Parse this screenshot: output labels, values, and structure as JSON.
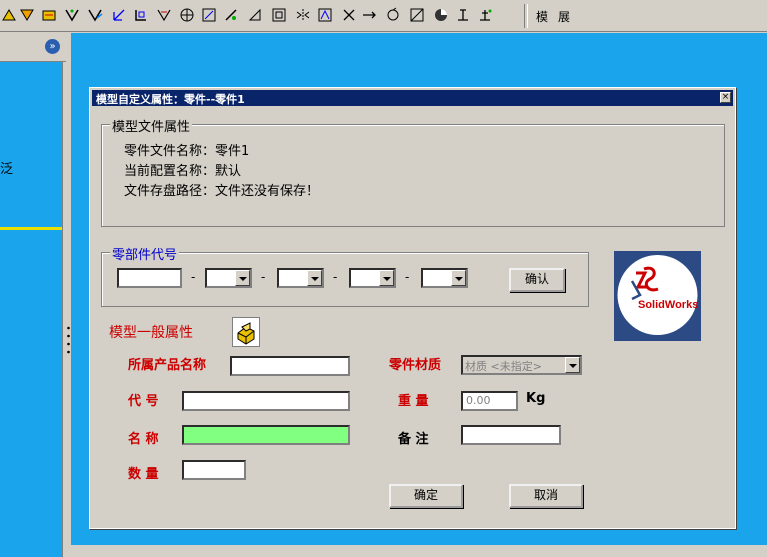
{
  "toolbar": {
    "icons": [
      "trim-icon",
      "dimension-icon",
      "smart-dimension-icon",
      "relation-icon",
      "display-relation-icon",
      "axis-icon",
      "coordinate-icon",
      "trim-entities-icon",
      "linear-pattern-icon",
      "offset-icon",
      "sketch-fillet-icon",
      "chamfer-icon",
      "block-icon",
      "mirror-icon",
      "convert-entities-icon",
      "split-icon",
      "move-icon",
      "rotate-icon",
      "scale-icon",
      "copy-icon",
      "modify-icon",
      "spline-icon"
    ],
    "text1": "模",
    "text2": "展"
  },
  "left_panel": {
    "collapse_glyph": "»",
    "fragment_text": "泛"
  },
  "dialog": {
    "title": "模型自定义属性：零件--零件1",
    "close_glyph": "×",
    "file_group": {
      "caption": "模型文件属性",
      "file_name": "零件文件名称：零件1",
      "config_name": "当前配置名称：默认",
      "save_path": "文件存盘路径：文件还没有保存！"
    },
    "part_code": {
      "caption": "零部件代号",
      "dash": "-",
      "confirm_label": "确认"
    },
    "general": {
      "caption": "模型一般属性",
      "product_name_label": "所属产品名称",
      "product_name_value": "",
      "code_label": "代 号",
      "code_value": "",
      "name_label": "名 称",
      "name_value": "",
      "qty_label": "数 量",
      "qty_value": "",
      "material_label": "零件材质",
      "material_value": "材质 <未指定>",
      "weight_label": "重 量",
      "weight_value": "0.00",
      "weight_unit": "Kg",
      "remark_label": "备 注",
      "remark_value": ""
    },
    "buttons": {
      "ok": "确定",
      "cancel": "取消"
    },
    "logo": {
      "text": "SolidWorks"
    }
  },
  "colors": {
    "viewport_blue": "#1aa4ec",
    "title_bar": "#0a246a",
    "label_red": "#cc0000",
    "name_field_green": "#80ff80"
  }
}
